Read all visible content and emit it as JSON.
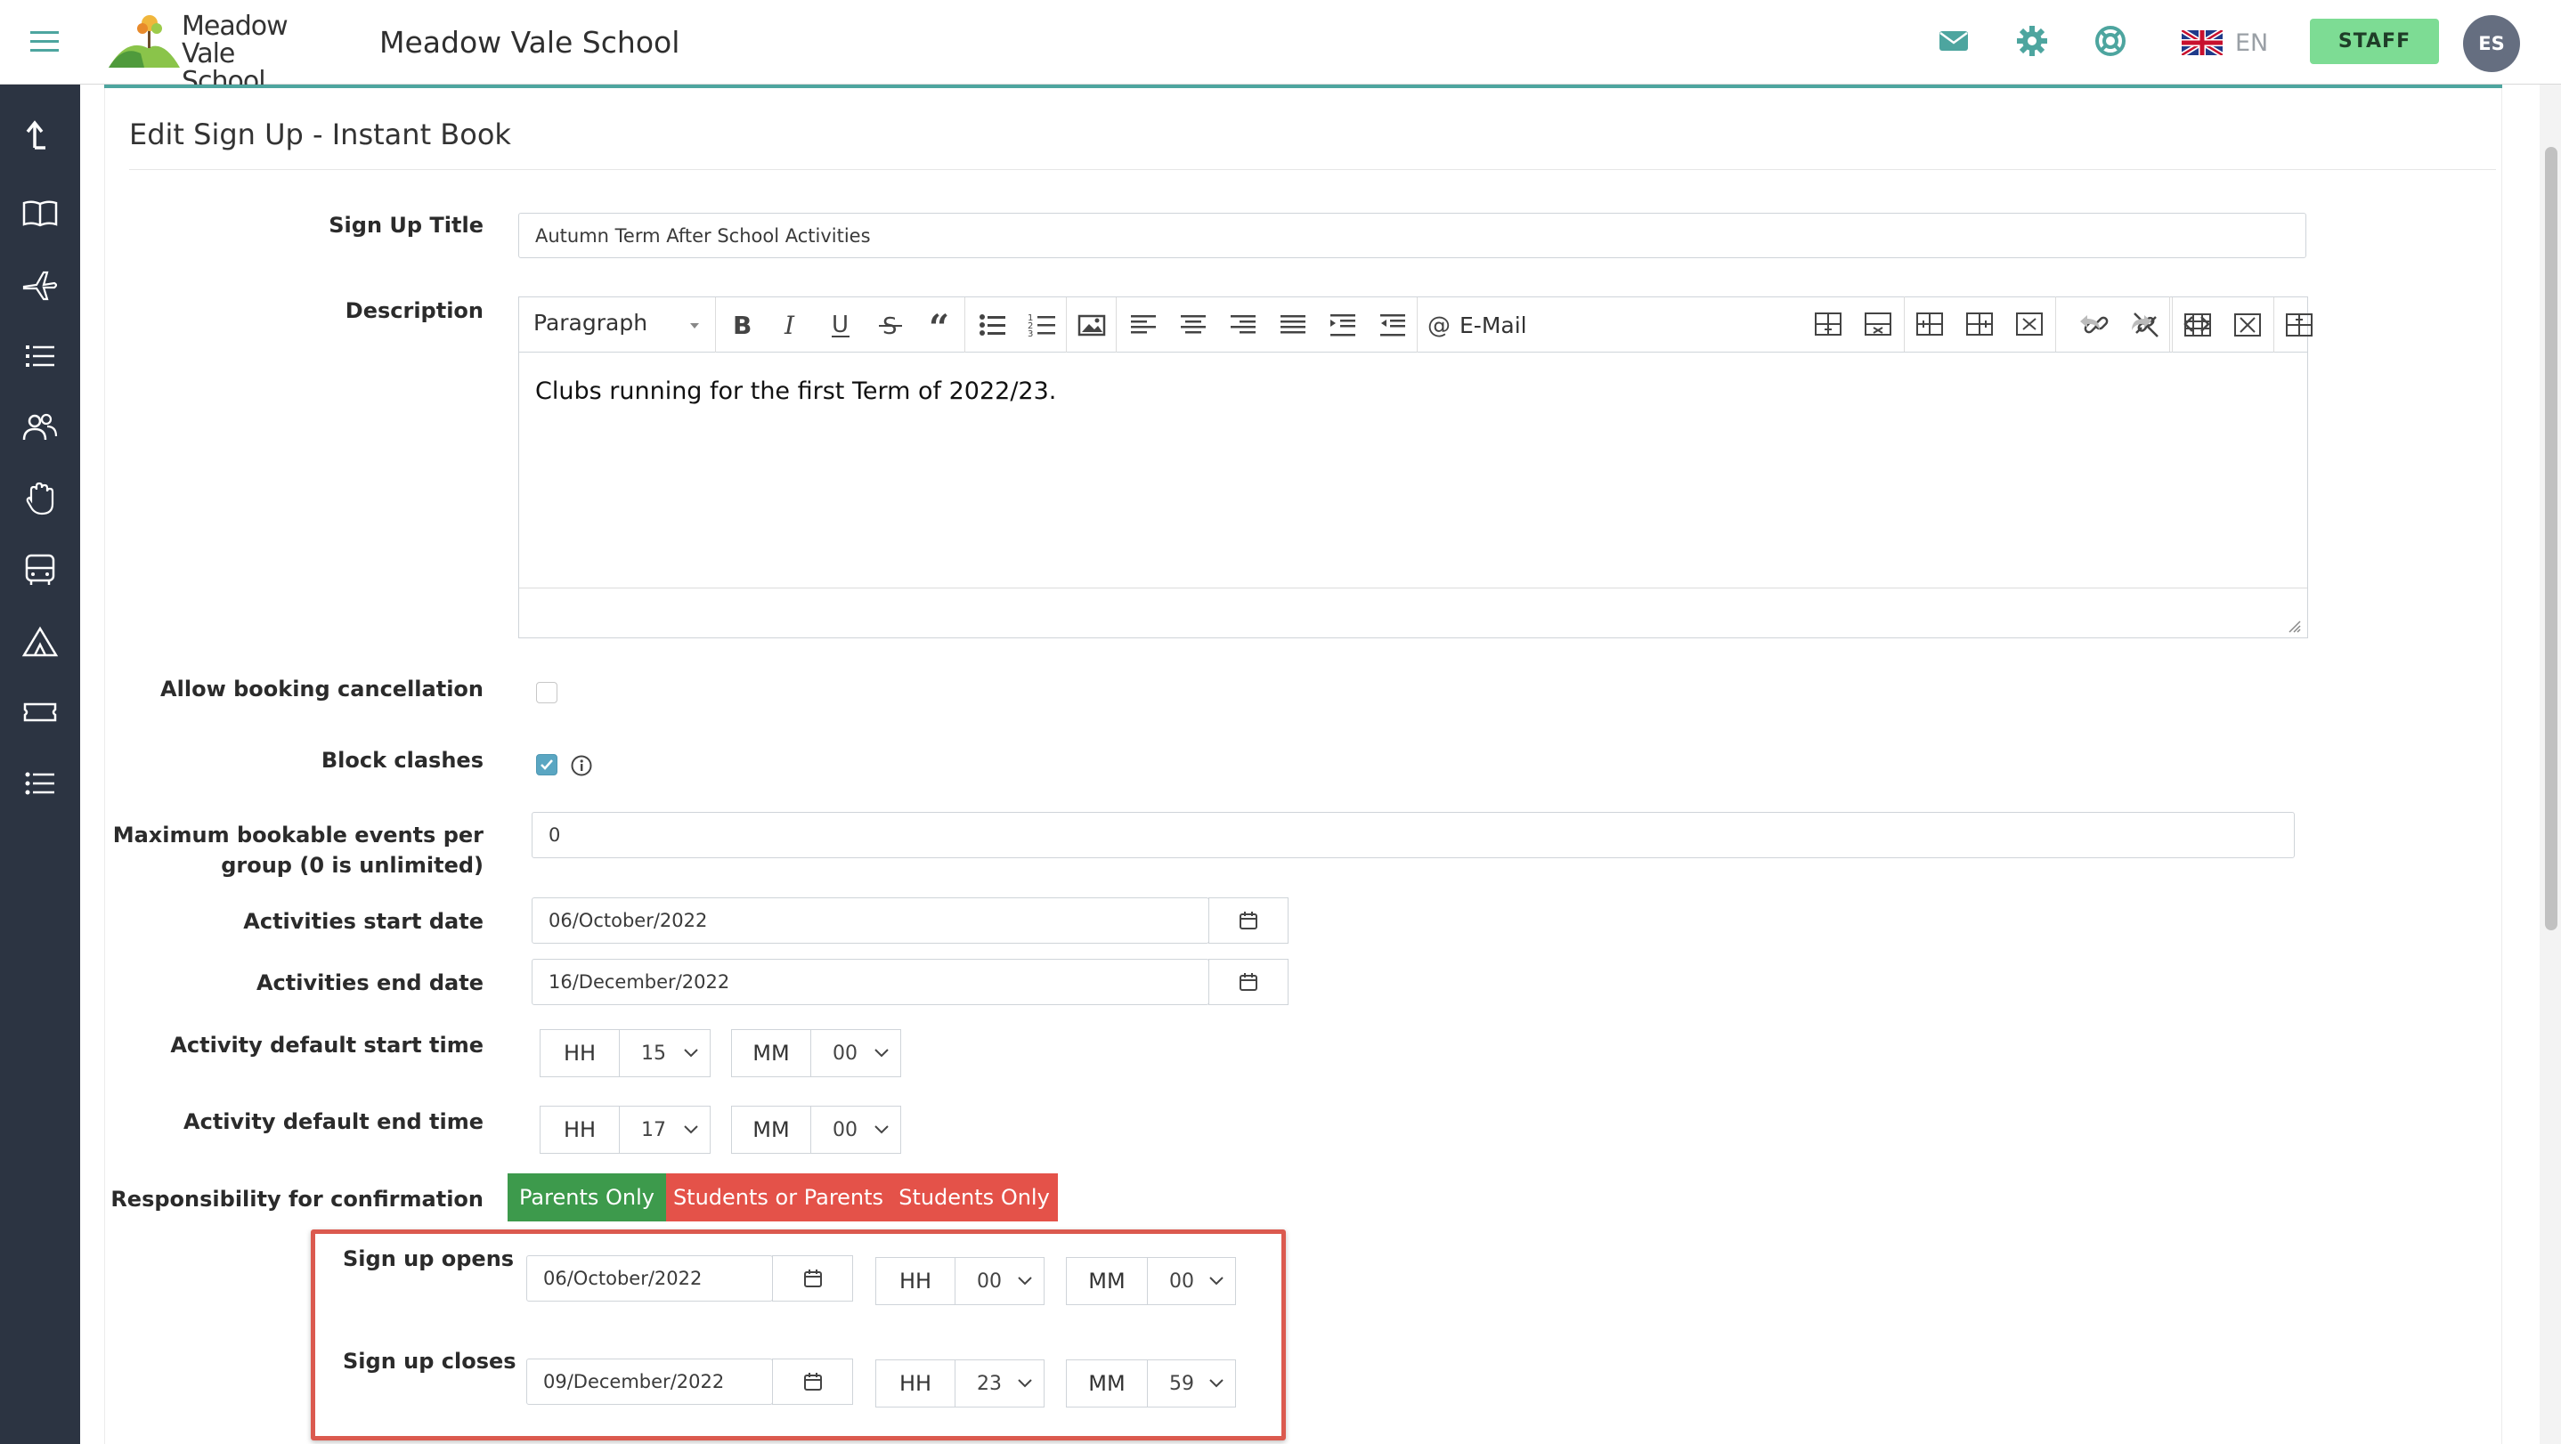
{
  "header": {
    "logo_line1": "Meadow",
    "logo_line2": "Vale School",
    "school_name": "Meadow Vale School",
    "language": "EN",
    "staff_label": "STAFF",
    "avatar_initials": "ES"
  },
  "sidebar": {
    "icons": [
      "upload-arrow-icon",
      "book-icon",
      "plane-icon",
      "list-icon",
      "users-icon",
      "hand-icon",
      "bus-icon",
      "tent-icon",
      "ticket-icon",
      "checklist-icon"
    ]
  },
  "page": {
    "title": "Edit Sign Up - Instant Book"
  },
  "form": {
    "signup_title_label": "Sign Up Title",
    "signup_title_value": "Autumn Term After School Activities",
    "description_label": "Description",
    "editor_paragraph": "Paragraph",
    "editor_email_label": "E-Mail",
    "editor_body": "Clubs running for the first Term of 2022/23.",
    "allow_cancellation_label": "Allow booking cancellation",
    "allow_cancellation_checked": false,
    "block_clashes_label": "Block clashes",
    "block_clashes_checked": true,
    "max_events_label_line1": "Maximum bookable events per",
    "max_events_label_line2": "group (0 is unlimited)",
    "max_events_value": "0",
    "start_date_label": "Activities start date",
    "start_date_value": "06/October/2022",
    "end_date_label": "Activities end date",
    "end_date_value": "16/December/2022",
    "default_start_label": "Activity default start time",
    "default_start_hh": "15",
    "default_start_mm": "00",
    "default_end_label": "Activity default end time",
    "default_end_hh": "17",
    "default_end_mm": "00",
    "hh_label": "HH",
    "mm_label": "MM",
    "responsibility_label": "Responsibility for confirmation",
    "responsibility_options": [
      "Parents Only",
      "Students or Parents",
      "Students Only"
    ],
    "signup_opens_label": "Sign up opens",
    "signup_opens_date": "06/October/2022",
    "signup_opens_hh": "00",
    "signup_opens_mm": "00",
    "signup_closes_label": "Sign up closes",
    "signup_closes_date": "09/December/2022",
    "signup_closes_hh": "23",
    "signup_closes_mm": "59"
  },
  "colors": {
    "accent": "#4da59f",
    "sidebar_bg": "#2c3442",
    "staff_button": "#7ddc94",
    "selected_option": "#3d9a4c",
    "unselected_option": "#e45249",
    "highlight_border": "#db5a4f"
  }
}
